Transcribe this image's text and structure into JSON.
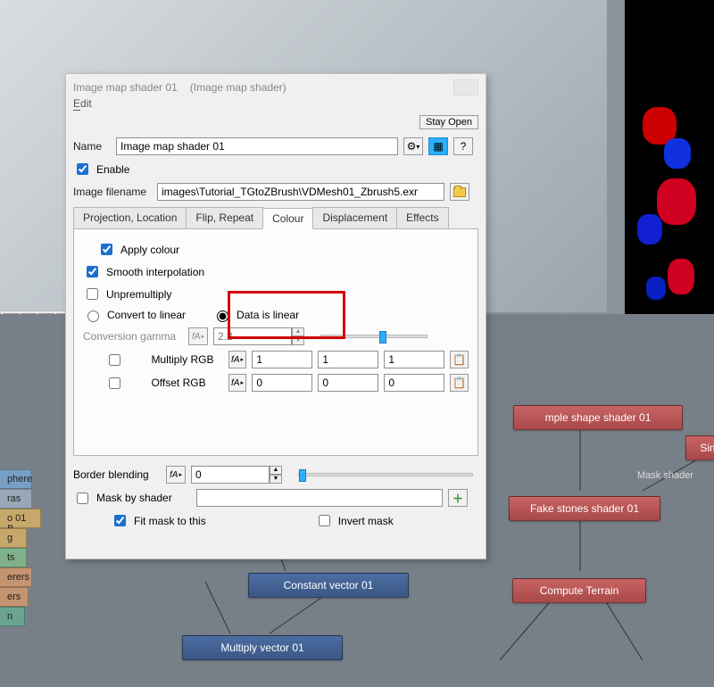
{
  "window": {
    "title_main": "Image map shader 01",
    "title_type": "(Image map shader)",
    "menu_edit": "Edit",
    "stay_open": "Stay Open"
  },
  "fields": {
    "name_label": "Name",
    "name_value": "Image map shader 01",
    "gear_icon": "settings",
    "enable_label": "Enable",
    "image_filename_label": "Image filename",
    "image_filename_value": "images\\Tutorial_TGtoZBrush\\VDMesh01_Zbrush5.exr"
  },
  "tabs": {
    "t0": "Projection, Location",
    "t1": "Flip, Repeat",
    "t2": "Colour",
    "t3": "Displacement",
    "t4": "Effects"
  },
  "colour": {
    "apply_colour": "Apply colour",
    "smooth_interpolation": "Smooth interpolation",
    "unpremultiply": "Unpremultiply",
    "convert_to_linear": "Convert to linear",
    "data_is_linear": "Data is linear",
    "conversion_gamma": "Conversion gamma",
    "gamma_value": "2.2",
    "multiply_rgb": "Multiply RGB",
    "mult_r": "1",
    "mult_g": "1",
    "mult_b": "1",
    "offset_rgb": "Offset RGB",
    "off_r": "0",
    "off_g": "0",
    "off_b": "0"
  },
  "bottom": {
    "border_blending": "Border blending",
    "border_value": "0",
    "mask_by_shader": "Mask by shader",
    "mask_value": "",
    "fit_mask": "Fit mask to this",
    "invert_mask": "Invert mask"
  },
  "sidebar": {
    "i0": "phere",
    "i1": "ras",
    "i2": "o 01 B...",
    "i3": "g",
    "i4": "ts",
    "i5": "erers",
    "i6": "ers",
    "i7": "n"
  },
  "nodes": {
    "constant_vector": "Constant vector 01",
    "multiply_vector": "Multiply vector 01",
    "simple_shape": "mple shape shader 01",
    "simp_cut": "Simp",
    "mask_shader_label": "Mask shader",
    "fake_stones": "Fake stones shader 01",
    "compute_terrain": "Compute Terrain"
  }
}
